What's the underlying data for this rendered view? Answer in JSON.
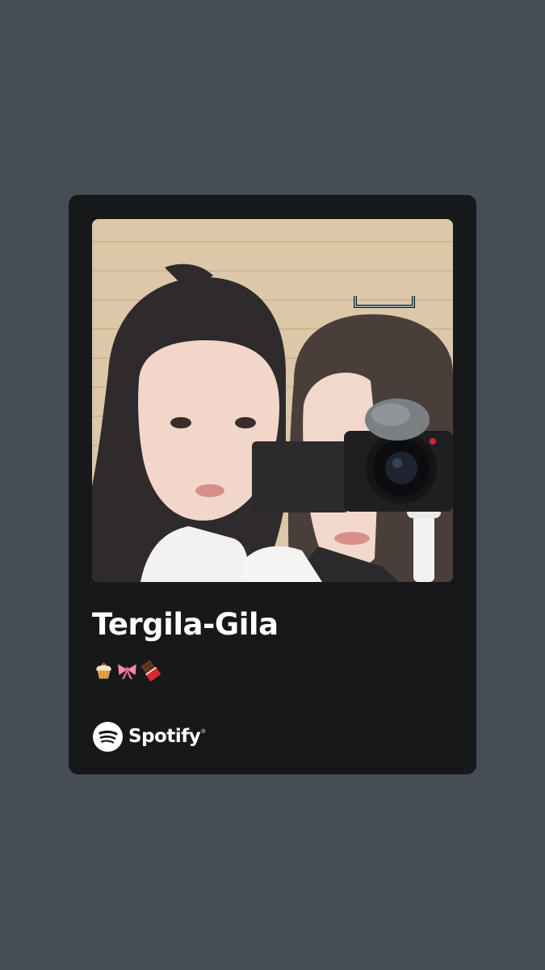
{
  "card": {
    "title": "Tergila-Gila",
    "emoji_icons": [
      "cupcake-icon",
      "ribbon-icon",
      "chocolate-bar-icon"
    ],
    "brand_name": "Spotify",
    "brand_mark": "®"
  },
  "colors": {
    "page_background": "#474d55",
    "card_background": "#171819",
    "text": "#ffffff"
  }
}
